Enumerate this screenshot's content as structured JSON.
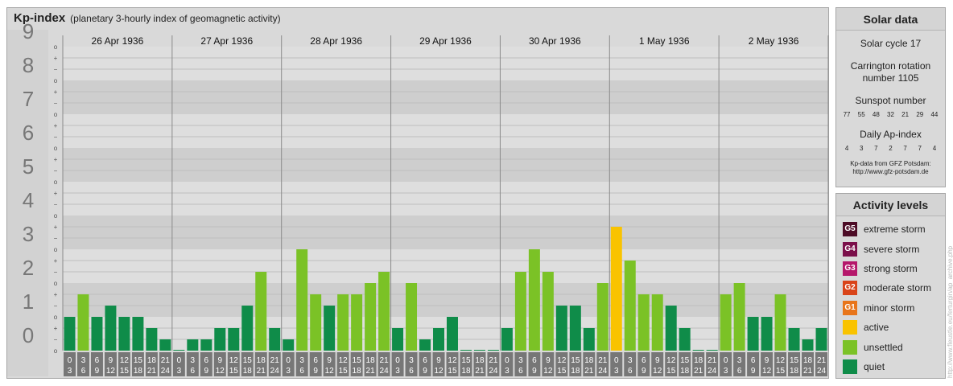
{
  "header": {
    "title": "Kp-index",
    "subtitle": "(planetary 3-hourly index of geomagnetic activity)"
  },
  "chart_data": {
    "type": "bar",
    "title": "Kp-index",
    "subtitle": "(planetary 3-hourly index of geomagnetic activity)",
    "ylim": [
      0,
      9
    ],
    "yticks": [
      "0",
      "1",
      "2",
      "3",
      "4",
      "5",
      "6",
      "7",
      "8",
      "9"
    ],
    "minor_tick_symbols": [
      "−",
      "+",
      "o"
    ],
    "days": [
      "26 Apr 1936",
      "27 Apr 1936",
      "28 Apr 1936",
      "29 Apr 1936",
      "30 Apr 1936",
      "1 May 1936",
      "2 May 1936"
    ],
    "slot_labels_top": [
      "0",
      "3",
      "6",
      "9",
      "12",
      "15",
      "18",
      "21"
    ],
    "slot_labels_bottom": [
      "3",
      "6",
      "9",
      "12",
      "15",
      "18",
      "21",
      "24"
    ],
    "series": [
      {
        "values": [
          1.0,
          1.667,
          1.0,
          1.333,
          1.0,
          1.0,
          0.667,
          0.333,
          0.0,
          0.333,
          0.333,
          0.667,
          0.667,
          1.333,
          2.333,
          0.667,
          0.333,
          3.0,
          1.667,
          1.333,
          1.667,
          1.667,
          2.0,
          2.333,
          0.667,
          2.0,
          0.333,
          0.667,
          1.0,
          0.0,
          0.0,
          0.0,
          0.667,
          2.333,
          3.0,
          2.333,
          1.333,
          1.333,
          0.667,
          2.0,
          3.667,
          2.667,
          1.667,
          1.667,
          1.333,
          0.667,
          0.0,
          0.0,
          1.667,
          2.0,
          1.0,
          1.0,
          1.667,
          0.667,
          0.333,
          0.667
        ]
      }
    ],
    "level_colors": {
      "quiet": "#0f8c49",
      "unsettled": "#7bc226",
      "active": "#f9c300"
    },
    "grid": true
  },
  "solar": {
    "heading": "Solar data",
    "cycle": "Solar cycle 17",
    "carrington": "Carrington rotation number 1105",
    "sunspot_label": "Sunspot number",
    "sunspot_values": [
      "77",
      "55",
      "48",
      "32",
      "21",
      "29",
      "44"
    ],
    "ap_label": "Daily Ap-index",
    "ap_values": [
      "4",
      "3",
      "7",
      "2",
      "7",
      "7",
      "4"
    ],
    "credit_line1": "Kp-data from GFZ Potsdam:",
    "credit_line2": "http://www.gfz-potsdam.de"
  },
  "levels": {
    "heading": "Activity levels",
    "items": [
      {
        "code": "G5",
        "label": "extreme storm",
        "color": "#4d0c26"
      },
      {
        "code": "G4",
        "label": "severe storm",
        "color": "#7b0f4a"
      },
      {
        "code": "G3",
        "label": "strong storm",
        "color": "#b5176b"
      },
      {
        "code": "G2",
        "label": "moderate storm",
        "color": "#d94419"
      },
      {
        "code": "G1",
        "label": "minor storm",
        "color": "#e8751a"
      },
      {
        "code": "",
        "label": "active",
        "color": "#f9c300"
      },
      {
        "code": "",
        "label": "unsettled",
        "color": "#7bc226"
      },
      {
        "code": "",
        "label": "quiet",
        "color": "#0f8c49"
      }
    ]
  },
  "watermark": "http://www.fleustle.eu/ferturgin/ap_archive.php"
}
